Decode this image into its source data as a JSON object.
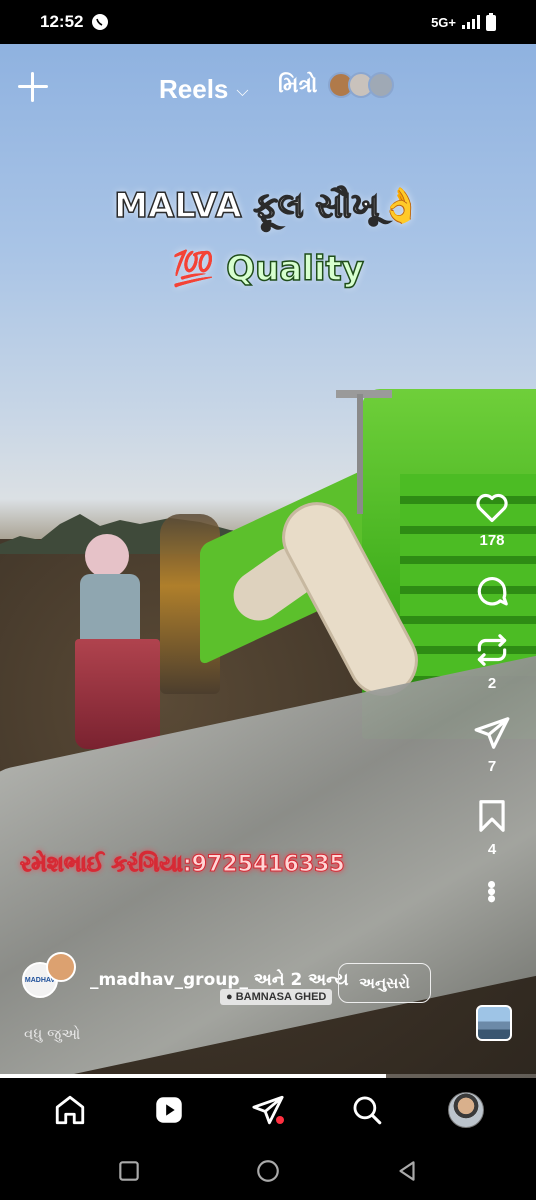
{
  "status": {
    "time": "12:52",
    "network": "5G+"
  },
  "header": {
    "title": "Reels",
    "friends_label": "મિત્રો"
  },
  "video": {
    "overlay_line1": "MALVA ફૂલ સૌખૂ👌",
    "overlay_line2": "💯 Quality",
    "phone_text": "રમેશભાઈ કરંગિયા:9725416335",
    "watermark": "● BAMNASA GHED"
  },
  "actions": {
    "likes": "178",
    "reposts": "2",
    "shares": "7",
    "saves": "4"
  },
  "owner": {
    "name": "_madhav_group_ અને 2 અન્ય",
    "avatar_text": "MADHAV",
    "follow_label": "અનુસરો",
    "see_more": "વધુ જુઓ"
  },
  "progress": 0.72,
  "colors": {
    "accent_red": "#ff3040",
    "machine_green": "#3fae1c"
  },
  "icons": [
    "plus-icon",
    "chevron-down-icon",
    "heart-icon",
    "comment-icon",
    "repost-icon",
    "send-icon",
    "bookmark-icon",
    "more-icon",
    "home-icon",
    "reels-icon",
    "direct-icon",
    "search-icon",
    "profile-avatar",
    "back-icon",
    "home-circle-icon",
    "recents-icon"
  ]
}
